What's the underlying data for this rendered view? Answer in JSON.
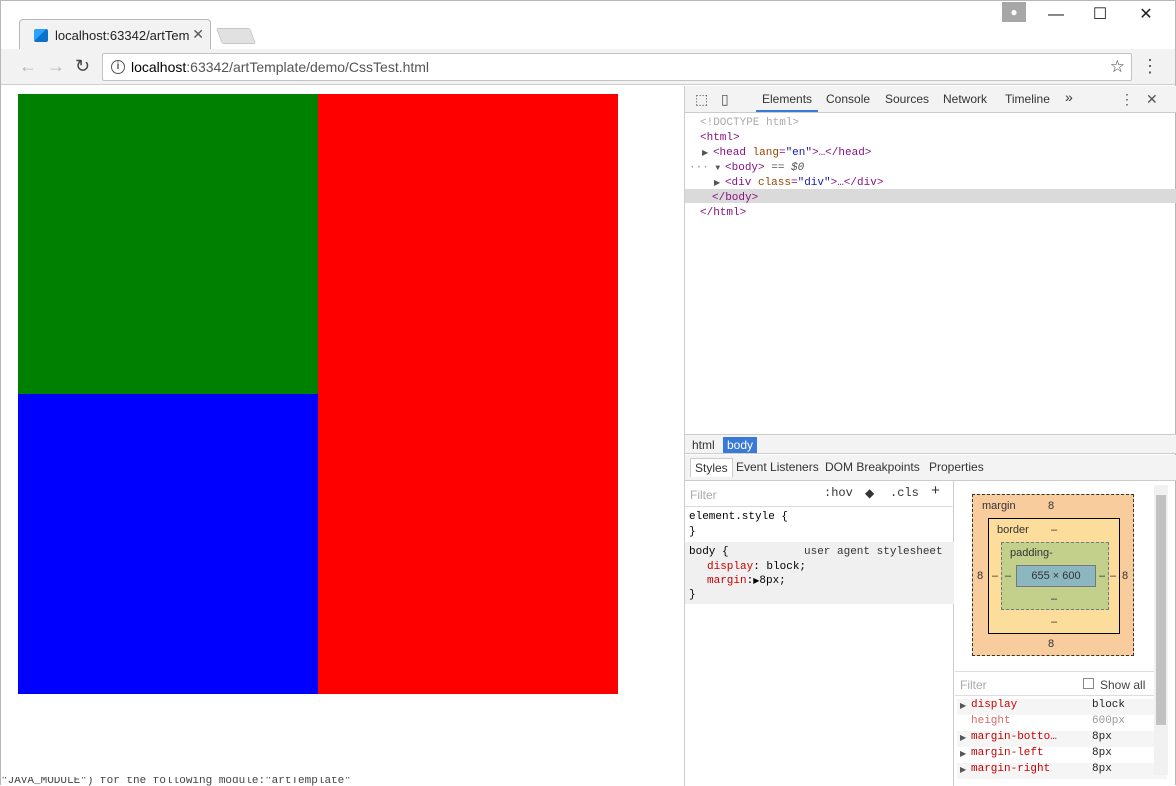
{
  "browser": {
    "tab_title": "localhost:63342/artTem",
    "url_host": "localhost",
    "url_rest": ":63342/artTemplate/demo/CssTest.html"
  },
  "page": {
    "blocks": [
      {
        "name": "green-block",
        "color": "#008000"
      },
      {
        "name": "red-block",
        "color": "#ff0000"
      },
      {
        "name": "blue-block",
        "color": "#0000ff"
      }
    ]
  },
  "devtools": {
    "tabs": [
      "Elements",
      "Console",
      "Sources",
      "Network",
      "Timeline"
    ],
    "more": "»",
    "dom": {
      "doctype": "<!DOCTYPE html>",
      "html_open": "<html>",
      "head_tag": "<head ",
      "head_attr": "lang",
      "head_val": "\"en\"",
      "head_end": ">…</head>",
      "body_tag": "<body>",
      "body_sel": " == $0",
      "div_tag": "<div ",
      "div_attr": "class",
      "div_val": "\"div\"",
      "div_end": ">…</div>",
      "body_close": "</body>",
      "html_close": "</html>"
    },
    "breadcrumbs": [
      "html",
      "body"
    ],
    "subtabs": [
      "Styles",
      "Event Listeners",
      "DOM Breakpoints",
      "Properties"
    ],
    "styles": {
      "filter_placeholder": "Filter",
      "hov": ":hov",
      "cls": ".cls",
      "add": "+",
      "element_style": "element.style {",
      "close_brace": "}",
      "body_selector": "body {",
      "ua_label": "user agent stylesheet",
      "decls": [
        {
          "prop": "display",
          "value": "block;"
        },
        {
          "prop": "margin",
          "value": "8px;"
        }
      ]
    },
    "boxmodel": {
      "margin_label": "margin",
      "margin_top": "8",
      "margin_left": "8",
      "margin_right": "8",
      "margin_bottom": "8",
      "border_label": "border",
      "border_top": "–",
      "border_left": "–",
      "border_right": "–",
      "border_bottom": "–",
      "padding_label": "padding-",
      "padding_left": "–",
      "padding_right": "–",
      "padding_bottom": "–",
      "content": "655 × 600"
    },
    "computed": {
      "filter_placeholder": "Filter",
      "show_all": "Show all",
      "props": [
        {
          "name": "display",
          "value": "block"
        },
        {
          "name": "height",
          "value": "600px"
        },
        {
          "name": "margin-botto…",
          "value": "8px"
        },
        {
          "name": "margin-left",
          "value": "8px"
        },
        {
          "name": "margin-right",
          "value": "8px"
        }
      ]
    }
  },
  "status_text": "\"JAVA_MODULE\") for the following module:\"artTemplate\""
}
